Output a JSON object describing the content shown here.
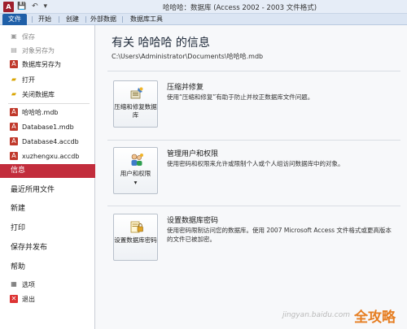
{
  "window": {
    "title": "哈哈哈：数据库 (Access 2002 - 2003 文件格式)",
    "app_icon": "A"
  },
  "ribbon": {
    "tabs": [
      {
        "label": "文件",
        "active": true
      },
      {
        "label": "开始"
      },
      {
        "label": "创建"
      },
      {
        "label": "外部数据"
      },
      {
        "label": "数据库工具"
      }
    ]
  },
  "nav": {
    "commands": [
      {
        "label": "保存",
        "icon": "save-icon",
        "disabled": true
      },
      {
        "label": "对象另存为",
        "icon": "save-as-icon",
        "disabled": true
      },
      {
        "label": "数据库另存为",
        "icon": "database-save-icon"
      },
      {
        "label": "打开",
        "icon": "folder-open-icon"
      },
      {
        "label": "关闭数据库",
        "icon": "close-database-icon"
      }
    ],
    "recent_files": [
      {
        "label": "哈哈哈.mdb"
      },
      {
        "label": "Database1.mdb"
      },
      {
        "label": "Database4.accdb"
      },
      {
        "label": "xuzhengxu.accdb"
      }
    ],
    "pages": [
      {
        "label": "信息",
        "active": true
      },
      {
        "label": "最近所用文件"
      },
      {
        "label": "新建"
      },
      {
        "label": "打印"
      },
      {
        "label": "保存并发布"
      },
      {
        "label": "帮助"
      }
    ],
    "options_label": "选项",
    "exit_label": "退出"
  },
  "main": {
    "title": "有关 哈哈哈 的信息",
    "path": "C:\\Users\\Administrator\\Documents\\哈哈哈.mdb",
    "sections": [
      {
        "button_label": "压缩和修复数据库",
        "heading": "压缩并修复",
        "description": "使用“压缩和修复”有助于防止并校正数据库文件问题。",
        "icon": "compact-repair-icon"
      },
      {
        "button_label": "用户和权限",
        "button_suffix": "▾",
        "heading": "管理用户和权限",
        "description": "使用密码和权限来允许或限制个人或个人组访问数据库中的对象。",
        "icon": "users-permissions-icon"
      },
      {
        "button_label": "设置数据库密码",
        "heading": "设置数据库密码",
        "description": "使用密码限制访问您的数据库。使用 2007 Microsoft Access 文件格式或更高版本的文件已被加密。",
        "icon": "database-password-icon"
      }
    ]
  },
  "watermark": {
    "text": "全攻略",
    "sub": "jingyan.baidu.com"
  }
}
